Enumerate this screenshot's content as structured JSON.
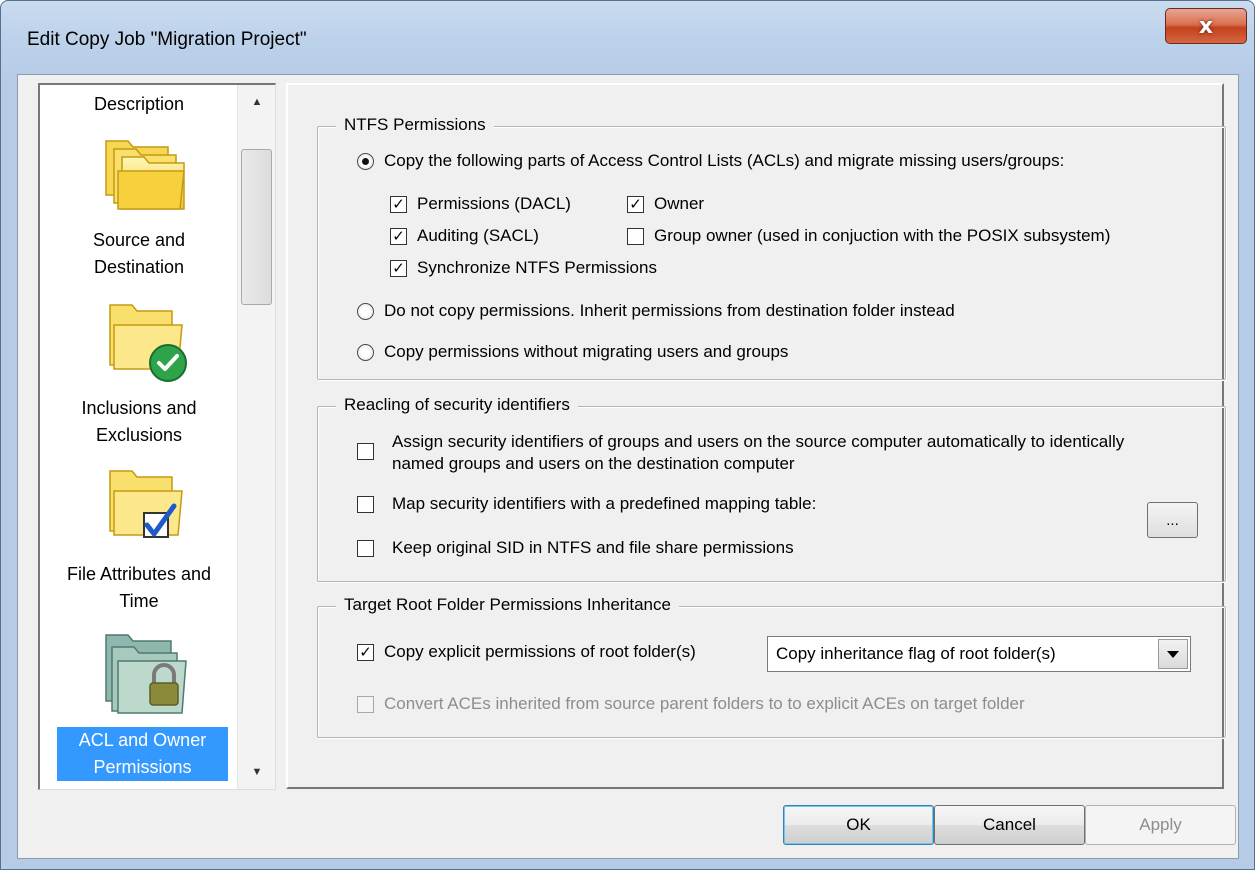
{
  "window": {
    "title": "Edit Copy Job \"Migration Project\"",
    "close_label": "x"
  },
  "sidebar": {
    "items": [
      {
        "label": "Description",
        "icon": "folder-stack-icon"
      },
      {
        "label": "Source and Destination",
        "icon": "folder-stack-icon"
      },
      {
        "label": "Inclusions and Exclusions",
        "icon": "folder-check-icon"
      },
      {
        "label": "File Attributes and Time",
        "icon": "folder-checkbox-icon"
      },
      {
        "label": "ACL and Owner Permissions",
        "icon": "folder-lock-icon",
        "selected": true
      }
    ],
    "scroll_up": "▲",
    "scroll_down": "▼"
  },
  "ntfs": {
    "title": "NTFS Permissions",
    "radio_copy_parts": {
      "label": "Copy the following parts of Access Control Lists (ACLs) and migrate missing users/groups:",
      "selected": true
    },
    "permissions_dacl": {
      "label": "Permissions (DACL)",
      "checked": true
    },
    "owner": {
      "label": "Owner",
      "checked": true
    },
    "auditing_sacl": {
      "label": "Auditing (SACL)",
      "checked": true
    },
    "group_owner": {
      "label": "Group owner (used in conjuction with the POSIX subsystem)",
      "checked": false
    },
    "synchronize": {
      "label": "Synchronize NTFS Permissions",
      "checked": true
    },
    "radio_no_copy": {
      "label": "Do not copy permissions. Inherit permissions from destination folder instead",
      "selected": false
    },
    "radio_no_migrate": {
      "label": "Copy permissions without migrating users and groups",
      "selected": false
    }
  },
  "reacling": {
    "title": "Reacling of security identifiers",
    "assign_auto": {
      "label": "Assign security identifiers of groups and users on the source computer automatically to identically named groups and users on the destination computer",
      "checked": false
    },
    "map_table": {
      "label": "Map security identifiers with a predefined mapping table:",
      "checked": false
    },
    "browse_button": "...",
    "keep_sid": {
      "label": "Keep original SID in NTFS and file share permissions",
      "checked": false
    }
  },
  "inheritance": {
    "title": "Target Root Folder Permissions Inheritance",
    "copy_explicit": {
      "label": "Copy explicit permissions of root folder(s)",
      "checked": true
    },
    "inheritance_select": {
      "value": "Copy inheritance flag of root folder(s)"
    },
    "convert_aces": {
      "label": "Convert ACEs inherited from source parent folders to to explicit ACEs on target folder",
      "checked": false,
      "disabled": true
    }
  },
  "buttons": {
    "ok": "OK",
    "cancel": "Cancel",
    "apply": "Apply"
  },
  "colors": {
    "selection": "#3399ff",
    "dialog_bg": "#f0f0f0",
    "close_button": "#c4411f"
  }
}
